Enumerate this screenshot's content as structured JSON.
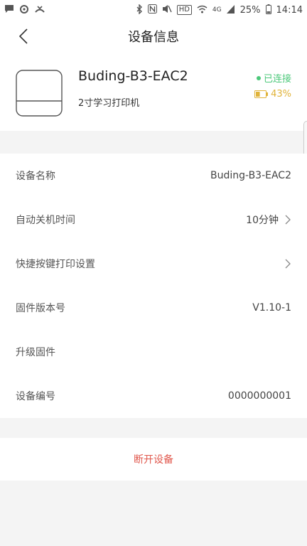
{
  "status_bar": {
    "hd": "HD",
    "network": "4G",
    "battery": "25%",
    "time": "14:14"
  },
  "header": {
    "title": "设备信息"
  },
  "device": {
    "name": "Buding-B3-EAC2",
    "type": "2寸学习打印机",
    "connection": "已连接",
    "battery": "43%",
    "battery_level": 0.43,
    "colors": {
      "connected": "#4cc87a",
      "battery": "#e0b33a"
    }
  },
  "settings": [
    {
      "label": "设备名称",
      "value": "Buding-B3-EAC2"
    },
    {
      "label": "自动关机时间",
      "value": "10分钟"
    },
    {
      "label": "快捷按键打印设置",
      "value": ""
    },
    {
      "label": "固件版本号",
      "value": "V1.10-1"
    },
    {
      "label": "升级固件",
      "value": ""
    },
    {
      "label": "设备编号",
      "value": "0000000001"
    }
  ],
  "actions": {
    "disconnect": "断开设备",
    "disconnect_color": "#e0574c"
  }
}
